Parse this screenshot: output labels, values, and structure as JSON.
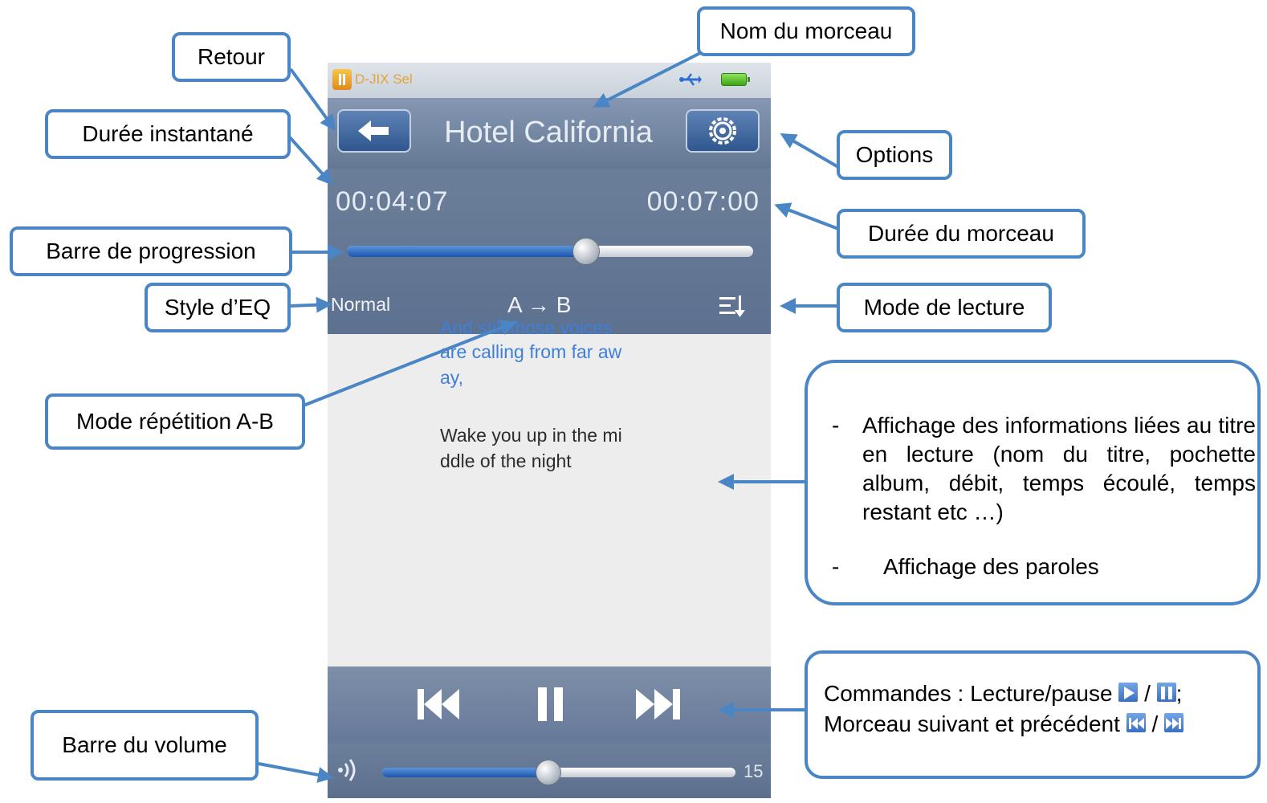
{
  "status_bar": {
    "app_name": "D-JIX Sel"
  },
  "player": {
    "track_title": "Hotel California",
    "elapsed": "00:04:07",
    "total": "00:07:00",
    "progress": 0.588,
    "eq_style": "Normal",
    "repeat_ab": "A → B",
    "lyrics": [
      "And still those voices",
      "are calling from far aw",
      "ay,",
      "Wake you up in the mi",
      "ddle of the night"
    ],
    "volume": 15,
    "volume_fraction": 0.47
  },
  "annotations": {
    "retour": "Retour",
    "nom_morceau": "Nom du morceau",
    "duree_instantane": "Durée instantané",
    "options": "Options",
    "duree_morceau": "Durée du morceau",
    "barre_progression": "Barre de progression",
    "style_eq": "Style d’EQ",
    "mode_lecture": "Mode de lecture",
    "mode_repetition": "Mode répétition A-B",
    "info_bullet_1": "Affichage des informations liées au titre en lecture (nom du titre, pochette album, débit, temps écoulé, temps restant etc …)",
    "info_bullet_2": "Affichage des paroles",
    "commandes_line1": "Commandes : Lecture/pause",
    "commandes_line2": "Morceau suivant et précédent",
    "barre_volume": "Barre du volume"
  },
  "colors": {
    "accent": "#4a86c5",
    "panel": "#647894",
    "progress": "#2a62b5"
  },
  "icons": [
    "back-arrow-icon",
    "gear-icon",
    "usb-icon",
    "battery-icon",
    "play-mode-icon",
    "previous-icon",
    "pause-icon",
    "next-icon",
    "speaker-icon"
  ]
}
